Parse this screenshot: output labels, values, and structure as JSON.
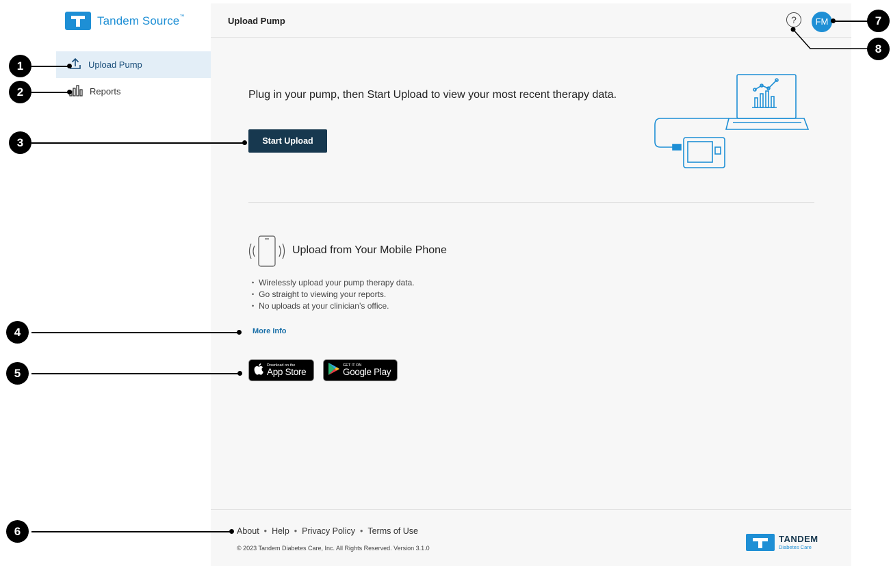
{
  "brand": {
    "name": "Tandem Source",
    "tm": "™"
  },
  "sidebar": {
    "items": [
      {
        "label": "Upload Pump",
        "icon": "upload-icon"
      },
      {
        "label": "Reports",
        "icon": "bar-chart-icon"
      }
    ]
  },
  "header": {
    "title": "Upload Pump",
    "help_icon": "?",
    "avatar": "FM"
  },
  "main": {
    "intro": "Plug in your pump, then Start Upload to view your most recent therapy data.",
    "start_button": "Start Upload",
    "mobile": {
      "title": "Upload from Your Mobile Phone",
      "features": [
        "Wirelessly upload your pump therapy data.",
        "Go straight to viewing your reports.",
        "No uploads at your clinician’s office."
      ],
      "more_info": "More Info",
      "app_store": {
        "small": "Download on the",
        "big": "App Store"
      },
      "google_play": {
        "small": "GET IT ON",
        "big": "Google Play"
      }
    }
  },
  "footer": {
    "links": [
      "About",
      "Help",
      "Privacy Policy",
      "Terms of Use"
    ],
    "separator": "•",
    "copyright": "© 2023 Tandem Diabetes Care, Inc. All Rights Reserved. Version 3.1.0",
    "logo_name": "TANDEM",
    "logo_sub": "Diabetes Care"
  },
  "callouts": [
    "1",
    "2",
    "3",
    "4",
    "5",
    "6",
    "7",
    "8"
  ],
  "colors": {
    "accent": "#1e8fd5",
    "button": "#17384f",
    "link": "#1a6fa8",
    "active_nav": "#e3eef7"
  }
}
